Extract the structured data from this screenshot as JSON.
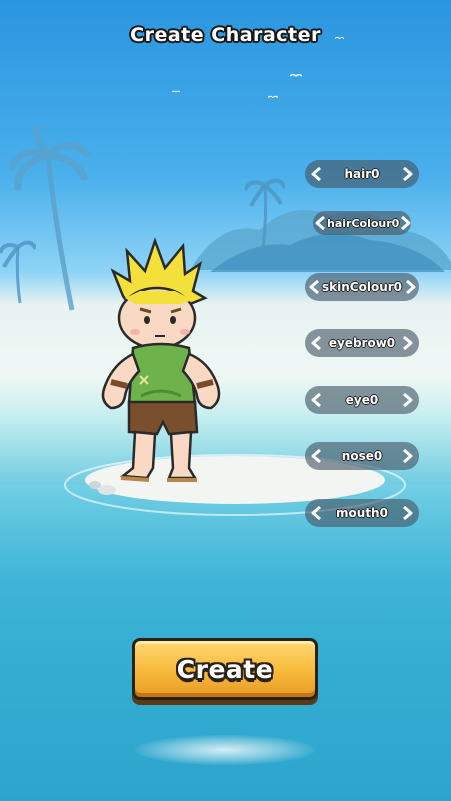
{
  "header": {
    "title": "Create Character"
  },
  "selectors": [
    {
      "id": "hair",
      "label": "hair0"
    },
    {
      "id": "hair-colour",
      "label": "hairColour0"
    },
    {
      "id": "skin-colour",
      "label": "skinColour0"
    },
    {
      "id": "eyebrow",
      "label": "eyebrow0"
    },
    {
      "id": "eye",
      "label": "eye0"
    },
    {
      "id": "nose",
      "label": "nose0"
    },
    {
      "id": "mouth",
      "label": "mouth0"
    }
  ],
  "actions": {
    "create_label": "Create"
  },
  "icons": {
    "prev": "chevron-left-icon",
    "next": "chevron-right-icon"
  },
  "colors": {
    "button": "#f7b93a",
    "sky": "#2a95df",
    "sea": "#39b0d3",
    "selector_bg": "#465564"
  }
}
